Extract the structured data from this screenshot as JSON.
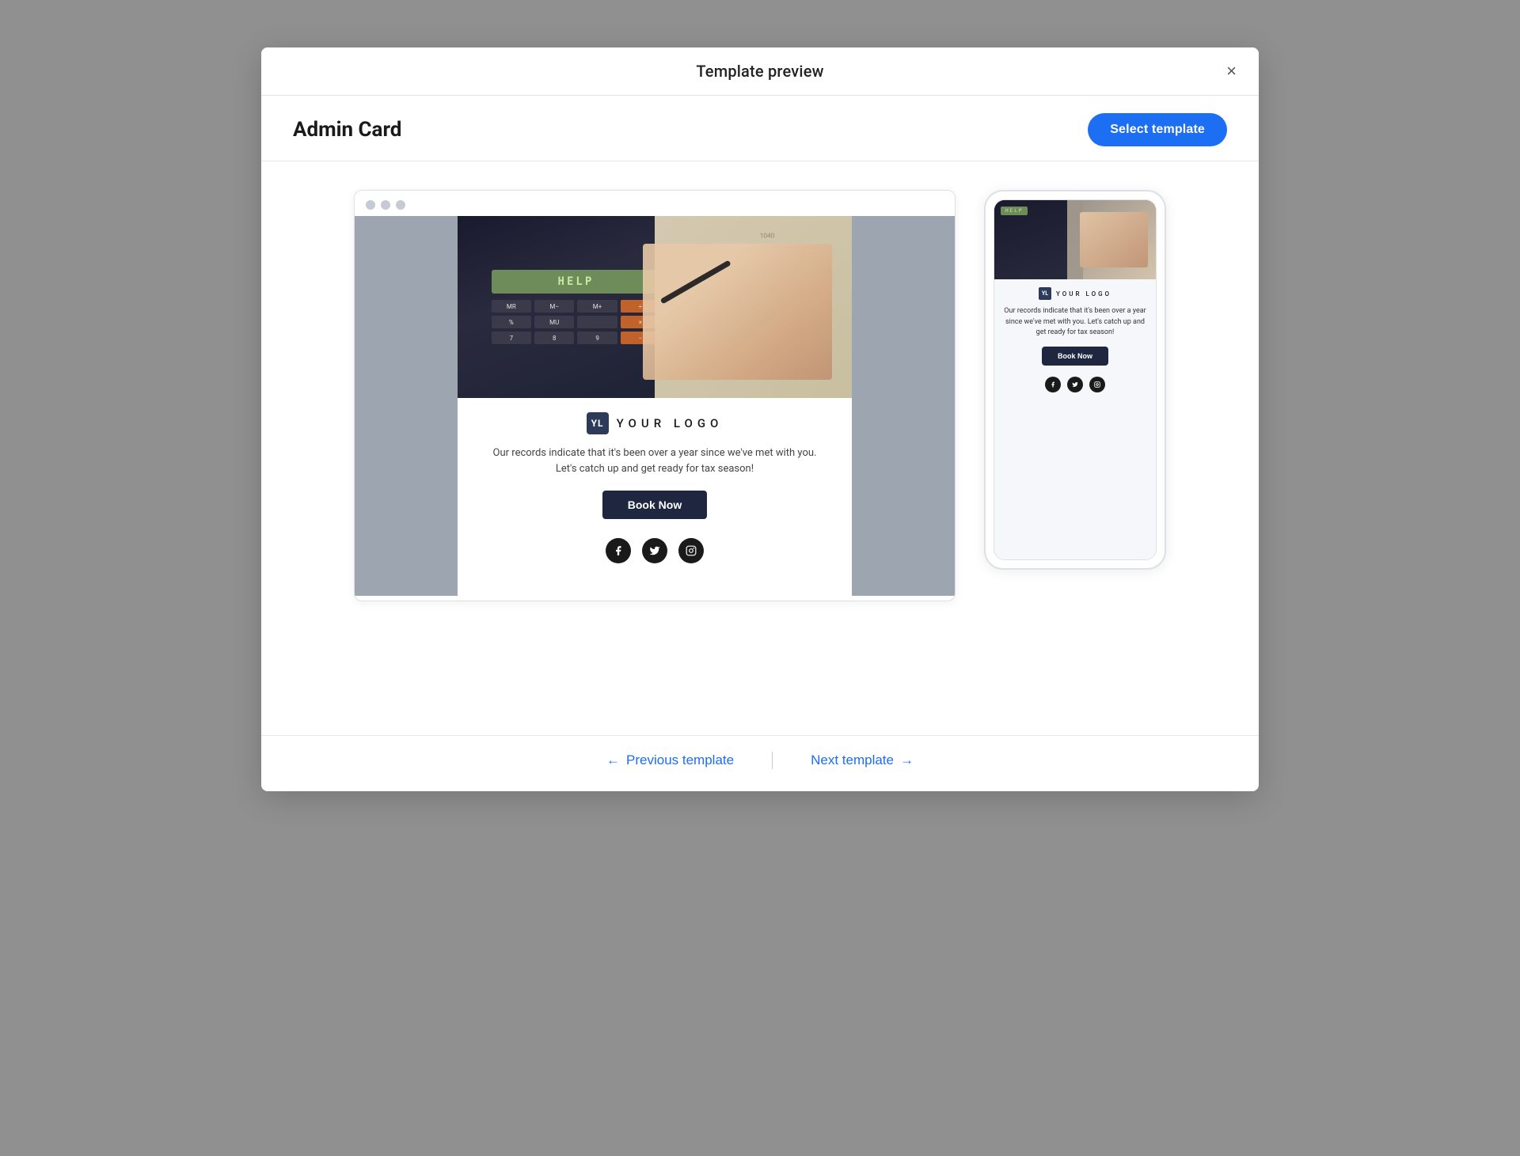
{
  "modal": {
    "title": "Template preview",
    "close_icon": "×"
  },
  "subheader": {
    "template_name": "Admin Card",
    "select_button_label": "Select template"
  },
  "desktop_preview": {
    "dots": [
      "dot1",
      "dot2",
      "dot3"
    ]
  },
  "template_content": {
    "logo_badge": "YL",
    "logo_text": "YOUR LOGO",
    "tagline_line1": "Our records indicate that it's been over a year since we've met with you.",
    "tagline_line2": "Let's catch up and get ready for tax season!",
    "cta_label": "Book Now",
    "calc_screen_text": "HELP",
    "social_icons": [
      "facebook",
      "twitter",
      "instagram"
    ]
  },
  "mobile_preview": {
    "logo_badge": "YL",
    "logo_text": "YOUR LOGO",
    "tagline": "Our records indicate that it's been over a year since we've met with you. Let's catch up and get ready for tax season!",
    "cta_label": "Book Now",
    "calc_screen_text": "HELP"
  },
  "footer": {
    "previous_label": "Previous template",
    "next_label": "Next template",
    "prev_arrow": "←",
    "next_arrow": "→"
  }
}
